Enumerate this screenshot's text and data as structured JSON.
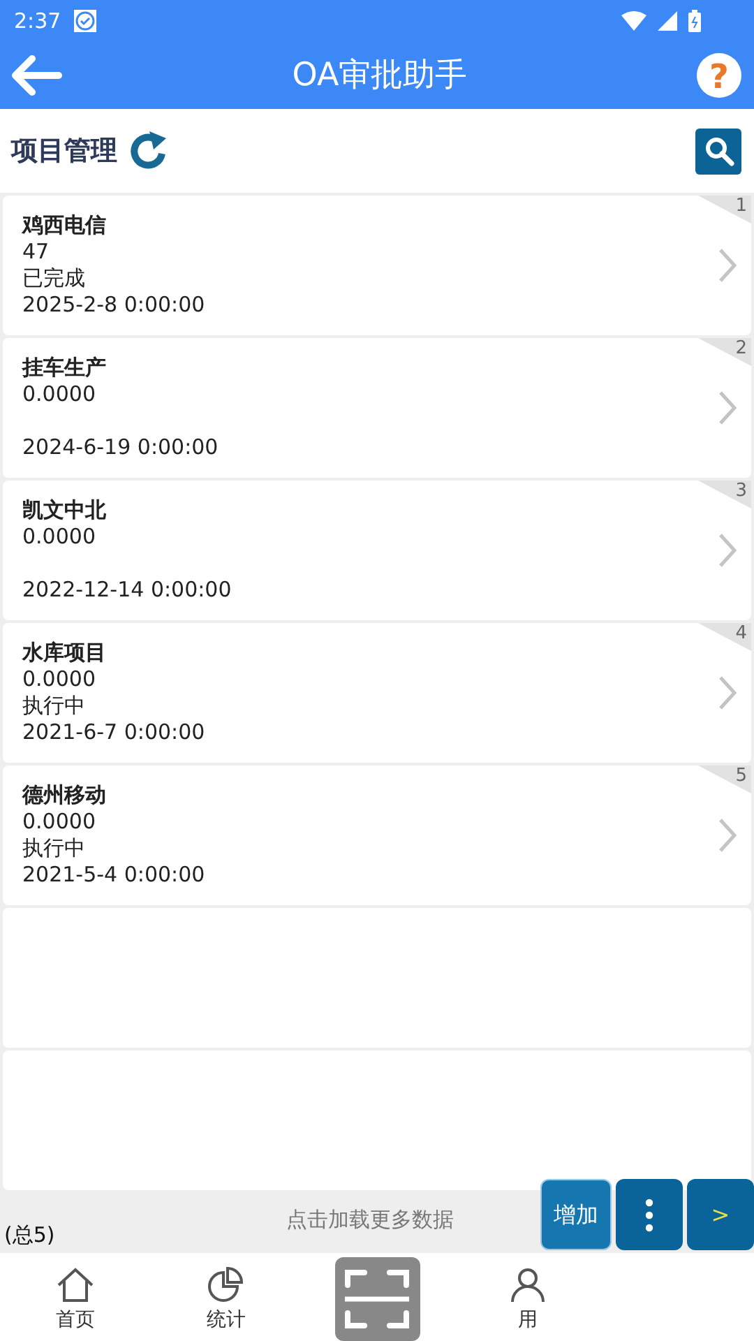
{
  "status_bar": {
    "time": "2:37"
  },
  "header": {
    "title": "OA审批助手",
    "help": "?"
  },
  "section": {
    "title": "项目管理"
  },
  "items": [
    {
      "index": "1",
      "name": "鸡西电信",
      "value": "47",
      "status": "已完成",
      "date": "2025-2-8 0:00:00"
    },
    {
      "index": "2",
      "name": "挂车生产",
      "value": "0.0000",
      "date": "2024-6-19 0:00:00"
    },
    {
      "index": "3",
      "name": "凯文中北",
      "value": "0.0000",
      "date": "2022-12-14 0:00:00"
    },
    {
      "index": "4",
      "name": "水库项目",
      "value": "0.0000",
      "status": "执行中",
      "date": "2021-6-7 0:00:00"
    },
    {
      "index": "5",
      "name": "德州移动",
      "value": "0.0000",
      "status": "执行中",
      "date": "2021-5-4 0:00:00"
    }
  ],
  "empty_cards": [
    {
      "kind": "empty"
    },
    {
      "kind": "empty"
    }
  ],
  "footer": {
    "load_more": "点击加载更多数据",
    "total": "(总5)"
  },
  "actions": [
    {
      "kind": "text",
      "label": "增加"
    },
    {
      "kind": "dots"
    },
    {
      "kind": "text",
      "label": ">"
    }
  ],
  "nav": [
    {
      "kind": "home",
      "label": "首页"
    },
    {
      "kind": "chart",
      "label": "统计"
    },
    {
      "kind": "scan"
    },
    {
      "kind": "user",
      "label": "用"
    }
  ]
}
